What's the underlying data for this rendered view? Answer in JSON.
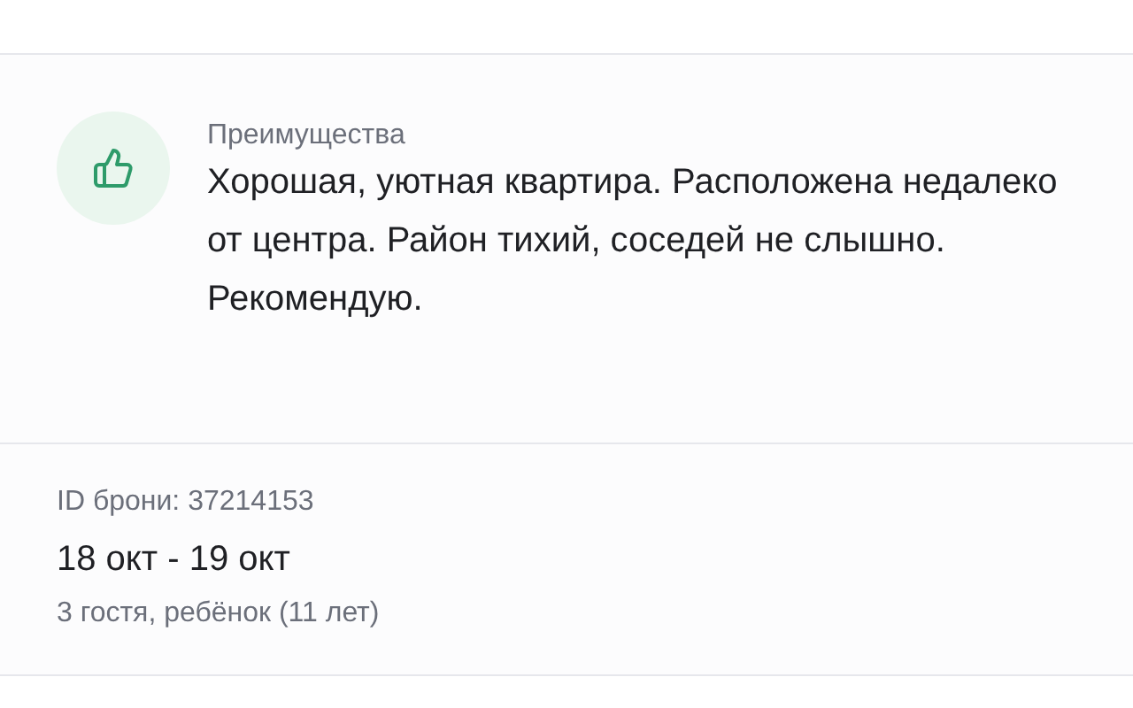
{
  "review": {
    "label": "Преимущества",
    "text": "Хорошая, уютная квартира. Расположена недалеко от центра. Район тихий, соседей не слышно. Рекомендую."
  },
  "booking": {
    "id": "ID брони: 37214153",
    "dates": "18 окт - 19 окт",
    "guests": "3 гостя, ребёнок (11 лет)"
  }
}
